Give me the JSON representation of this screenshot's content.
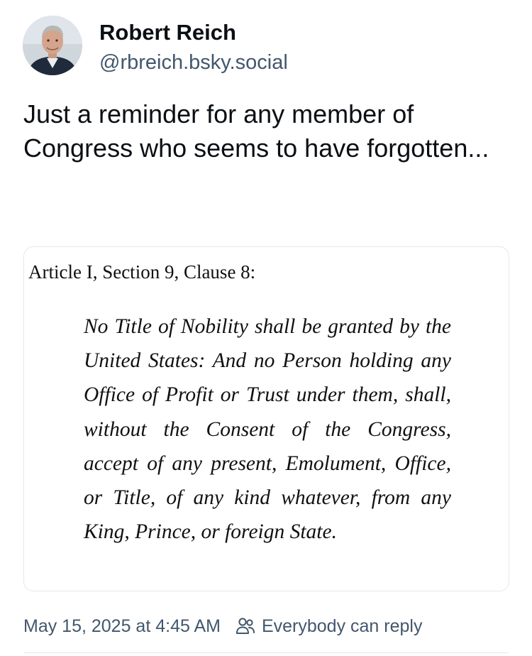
{
  "author": {
    "name": "Robert Reich",
    "handle": "@rbreich.bsky.social",
    "avatar_icon": "profile-photo"
  },
  "post": {
    "text": "Just a reminder for any member of Congress who seems to have forgotten..."
  },
  "embed": {
    "heading": "Article I, Section 9, Clause 8:",
    "body": "No Title of Nobility shall be granted by the United States: And no Person holding any Office of Profit or Trust under them, shall, without the Consent of the Congress, accept of any present, Emolument, Office, or Title, of any kind whatever, from any King, Prince, or foreign State."
  },
  "meta": {
    "timestamp": "May 15, 2025 at 4:45 AM",
    "reply_setting": "Everybody can reply",
    "reply_icon": "people-icon"
  },
  "colors": {
    "text_primary": "#0b0f14",
    "text_secondary": "#42576c",
    "border": "#e4e8ec"
  }
}
